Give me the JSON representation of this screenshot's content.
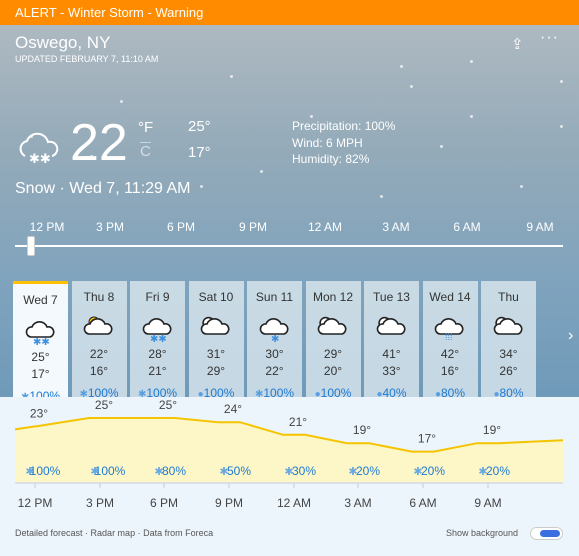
{
  "alert": "ALERT - Winter Storm - Warning",
  "location": "Oswego, NY",
  "updated": "UPDATED FEBRUARY 7, 11:10 AM",
  "current": {
    "temp": "22",
    "unit_f": "°F",
    "unit_c": "C",
    "high": "25°",
    "low": "17°",
    "precipitation": "Precipitation: 100%",
    "wind": "Wind: 6 MPH",
    "humidity": "Humidity: 82%",
    "condition": "Snow · Wed 7, 11:29 AM",
    "icon": "cloud-snow-icon"
  },
  "timeline": {
    "hours": [
      "12 PM",
      "3 PM",
      "6 PM",
      "9 PM",
      "12 AM",
      "3 AM",
      "6 AM",
      "9 AM"
    ],
    "slider_position": 0.03
  },
  "days": [
    {
      "label": "Wed 7",
      "icon": "snow",
      "high": "25°",
      "low": "17°",
      "precip": "100%",
      "ptype": "snow"
    },
    {
      "label": "Thu 8",
      "icon": "partly-sunny",
      "high": "22°",
      "low": "16°",
      "precip": "100%",
      "ptype": "snow"
    },
    {
      "label": "Fri 9",
      "icon": "snow",
      "high": "28°",
      "low": "21°",
      "precip": "100%",
      "ptype": "snow"
    },
    {
      "label": "Sat 10",
      "icon": "cloudy",
      "high": "31°",
      "low": "29°",
      "precip": "100%",
      "ptype": "rain"
    },
    {
      "label": "Sun 11",
      "icon": "light-snow",
      "high": "30°",
      "low": "22°",
      "precip": "100%",
      "ptype": "snow"
    },
    {
      "label": "Mon 12",
      "icon": "cloudy",
      "high": "29°",
      "low": "20°",
      "precip": "100%",
      "ptype": "rain"
    },
    {
      "label": "Tue 13",
      "icon": "cloudy",
      "high": "41°",
      "low": "33°",
      "precip": "40%",
      "ptype": "rain"
    },
    {
      "label": "Wed 14",
      "icon": "rain",
      "high": "42°",
      "low": "16°",
      "precip": "80%",
      "ptype": "rain"
    },
    {
      "label": "Thu",
      "icon": "cloudy",
      "high": "34°",
      "low": "26°",
      "precip": "80%",
      "ptype": "rain"
    }
  ],
  "hourly": {
    "times": [
      "12 PM",
      "3 PM",
      "6 PM",
      "9 PM",
      "12 AM",
      "3 AM",
      "6 AM",
      "9 AM"
    ],
    "temps": [
      23,
      25,
      25,
      24,
      21,
      19,
      17,
      19
    ],
    "temp_labels": [
      "23°",
      "25°",
      "25°",
      "24°",
      "21°",
      "19°",
      "17°",
      "19°"
    ],
    "precip": [
      "100%",
      "100%",
      "80%",
      "50%",
      "30%",
      "20%",
      "20%",
      "20%"
    ]
  },
  "footer": {
    "links": [
      "Detailed forecast",
      "Radar map",
      "Data from Foreca"
    ],
    "show_background": "Show background",
    "show_background_on": true
  },
  "colors": {
    "alert": "#ff8c00",
    "selected": "#ffc000",
    "precip": "#1f7ad1",
    "line": "#f5c400",
    "area": "#fdf7c8"
  }
}
